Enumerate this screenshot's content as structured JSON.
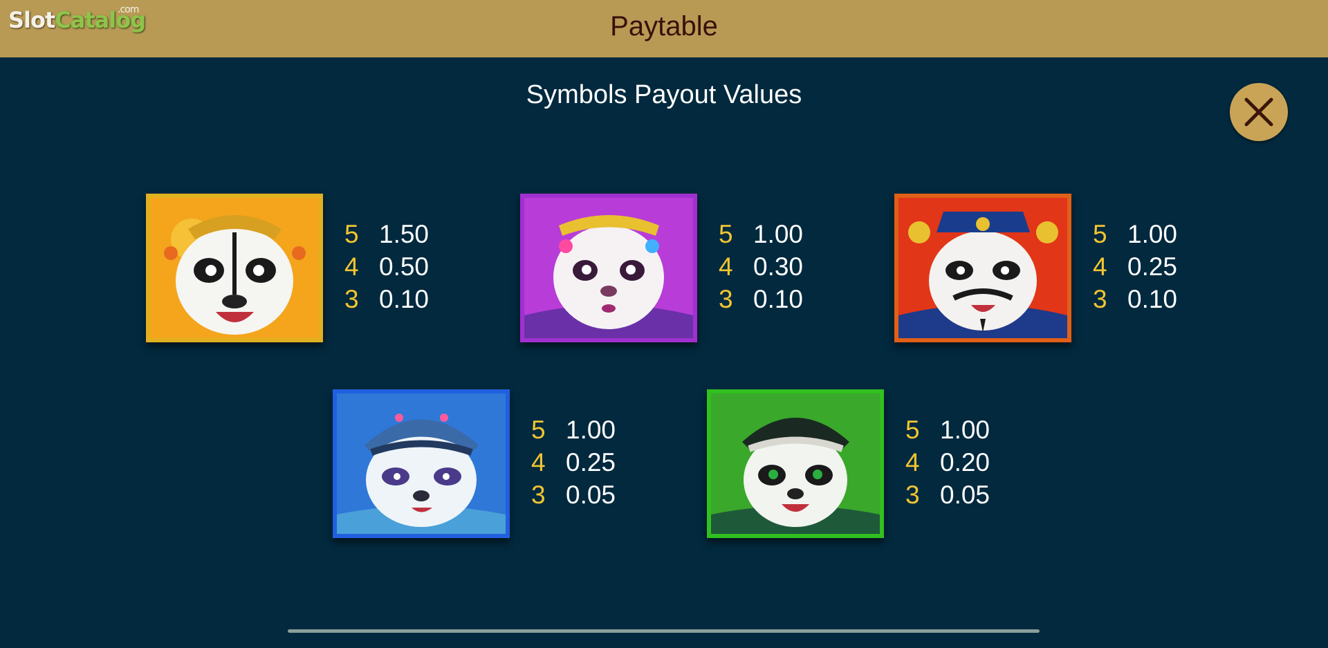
{
  "header": {
    "logo_slot": "Slot",
    "logo_catalog": "Catalog",
    "logo_dotcom": ".com",
    "title": "Paytable"
  },
  "subtitle": "Symbols Payout Values",
  "close_icon": "close-icon",
  "symbols": [
    {
      "name": "opera-panda-yellow",
      "frame_color": "#e0b020",
      "bg_color": "#f0a020",
      "payouts": [
        {
          "count": "5",
          "amount": "1.50"
        },
        {
          "count": "4",
          "amount": "0.50"
        },
        {
          "count": "3",
          "amount": "0.10"
        }
      ]
    },
    {
      "name": "princess-panda-purple",
      "frame_color": "#a030d0",
      "bg_color": "#c040e0",
      "payouts": [
        {
          "count": "5",
          "amount": "1.00"
        },
        {
          "count": "4",
          "amount": "0.30"
        },
        {
          "count": "3",
          "amount": "0.10"
        }
      ]
    },
    {
      "name": "official-panda-red",
      "frame_color": "#e06018",
      "bg_color": "#e03010",
      "payouts": [
        {
          "count": "5",
          "amount": "1.00"
        },
        {
          "count": "4",
          "amount": "0.25"
        },
        {
          "count": "3",
          "amount": "0.10"
        }
      ]
    },
    {
      "name": "warrior-panda-blue",
      "frame_color": "#2060e0",
      "bg_color": "#3080e8",
      "payouts": [
        {
          "count": "5",
          "amount": "1.00"
        },
        {
          "count": "4",
          "amount": "0.25"
        },
        {
          "count": "3",
          "amount": "0.05"
        }
      ]
    },
    {
      "name": "general-panda-green",
      "frame_color": "#30c020",
      "bg_color": "#40b030",
      "payouts": [
        {
          "count": "5",
          "amount": "1.00"
        },
        {
          "count": "4",
          "amount": "0.20"
        },
        {
          "count": "3",
          "amount": "0.05"
        }
      ]
    }
  ],
  "colors": {
    "background": "#02293e",
    "header": "#b89a55",
    "count": "#f2c531",
    "amount": "#ffffff"
  }
}
